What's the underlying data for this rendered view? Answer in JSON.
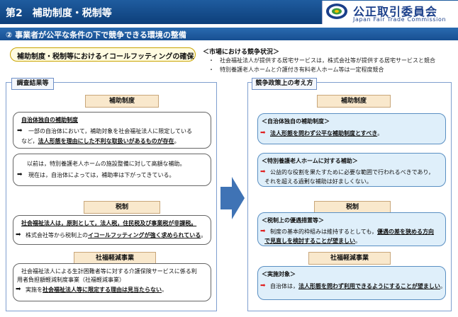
{
  "header": {
    "title": "第2　補助制度・税制等",
    "logo_name": "公正取引委員会",
    "logo_en": "Japan Fair Trade Commission"
  },
  "subheader": {
    "text": "② 事業者が公平な条件の下で競争できる環境の整備"
  },
  "pill": {
    "text": "補助制度・税制等におけるイコールフッティングの確保"
  },
  "market": {
    "heading": "＜市場における競争状況＞",
    "lines": [
      "・　社会福祉法人が提供する居宅サービスは，株式会社等が提供する居宅サービスと競合",
      "・　特別養護老人ホームと介護付き有料老人ホーム等は一定程度競合"
    ]
  },
  "left_panel": {
    "tab": "調査結果等",
    "sections": [
      {
        "head": "補助制度",
        "box1": {
          "title": "自治体独自の補助制度",
          "line1": "一部の自治体において，補助対象を社会福祉法人に限定している",
          "line2a": "など，",
          "line2b": "法人形態を理由にした不利な取扱いがあるものが存在",
          "line2c": "。"
        },
        "box2": {
          "line1": "以前は，特別養護老人ホームの施設整備に対して高額な補助。",
          "line2": "現在は，自治体によっては，補助率は下がってきている。"
        }
      },
      {
        "head": "税制",
        "line1": "社会福祉法人は，原則として，法人税，住民税及び事業税が非課税。",
        "line2a": "株式会社等から税制上の",
        "line2b": "イコールフッティングが強く求められている",
        "line2c": "。"
      },
      {
        "head": "社福軽減事業",
        "line1": "社会福祉法人による生計困難者等に対する介護保険サービスに係る利",
        "line2": "用者負担額軽減制度事業（社福軽減事業）",
        "line3a": "実施を",
        "line3b": "社会福祉法人等に限定する理由は見当たらない",
        "line3c": "。"
      }
    ]
  },
  "right_panel": {
    "tab": "競争政策上の考え方",
    "sections": [
      {
        "head": "補助制度",
        "box1": {
          "title": "＜自治体独自の補助制度＞",
          "line": "法人形態を問わず公平な補助制度とすべき",
          "tail": "。"
        },
        "box2": {
          "title": "＜特別養護老人ホームに対する補助＞",
          "line1": "公益的な役割を果たすために必要な範囲で行われるべきであり，",
          "line2": "それを超える過剰な補助は好ましくない。"
        }
      },
      {
        "head": "税制",
        "box": {
          "title": "＜税制上の優遇措置等＞",
          "line1a": "制度の基本的枠組みは維持するとしても，",
          "line1b": "優遇の差を狭める方向",
          "line2": "で見直しを検討することが望ましい",
          "line2c": "。"
        }
      },
      {
        "head": "社福軽減事業",
        "box": {
          "title": "＜実施対象＞",
          "line_a": "自治体は，",
          "line_b": "法人形態を問わず利用できるようにすることが望ましい",
          "line_c": "。"
        }
      }
    ]
  },
  "colors": {
    "header_blue": "#1f5c9f",
    "brand_navy": "#1b3f8a",
    "section_head_fill": "#f9e8cc",
    "highlight_box_fill": "#dfeffa",
    "arrow_black": "#111111",
    "arrow_red": "#e02020",
    "big_arrow": "#3f73b5"
  },
  "icons": {
    "logo": "jftc-logo-icon",
    "big_arrow": "right-arrow-icon",
    "bullet": "right-arrow-bullet-icon"
  }
}
